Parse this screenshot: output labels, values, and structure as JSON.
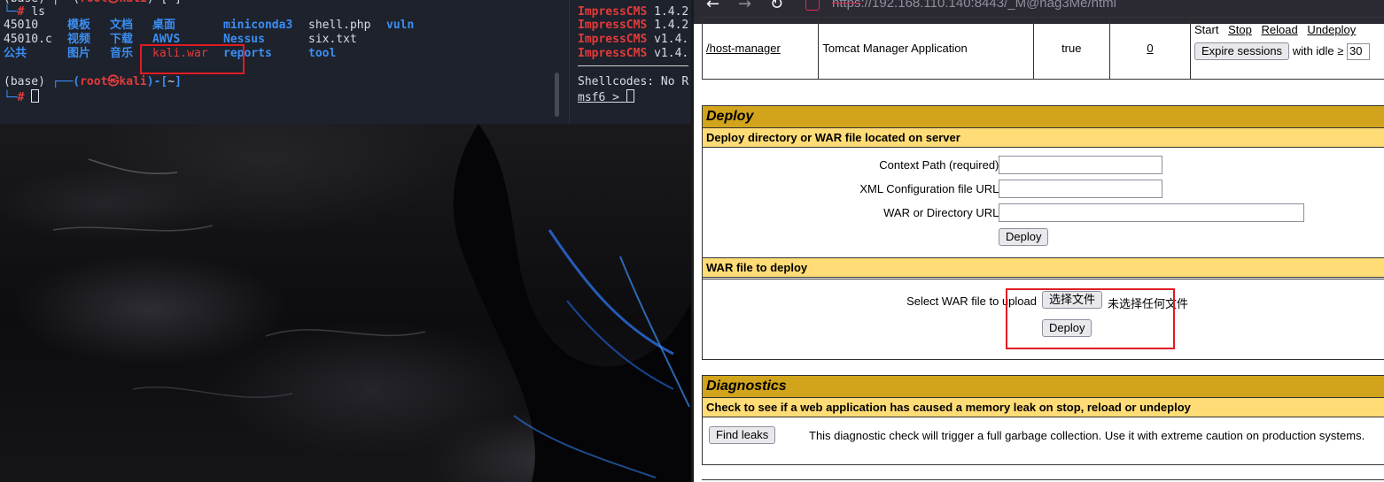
{
  "terminal_left": {
    "prompt_env": "(base)",
    "prompt_user": "root",
    "prompt_host": "kali",
    "prompt_dir": "~",
    "last_command": "ls",
    "ls_rows": [
      [
        "45010",
        "模板",
        "文档",
        "桌面",
        "miniconda3",
        "shell.php",
        "vuln"
      ],
      [
        "45010.c",
        "视频",
        "下载",
        "AWVS",
        "Nessus",
        "six.txt",
        ""
      ],
      [
        "公共",
        "图片",
        "音乐",
        "kali.war",
        "reports",
        "tool",
        ""
      ]
    ]
  },
  "terminal_right": {
    "search_rows": [
      [
        "ImpressCMS",
        "1.4.2"
      ],
      [
        "ImpressCMS",
        "1.4.2"
      ],
      [
        "ImpressCMS",
        "v1.4."
      ],
      [
        "ImpressCMS",
        "v1.4."
      ]
    ],
    "shellcodes_line": "Shellcodes: No R",
    "prompt": "msf6 > "
  },
  "browser": {
    "url_scheme": "https",
    "url_rest": "://192.168.110.140:8443/_M@nag3Me/html",
    "icons": {
      "back": "back-arrow-icon",
      "forward": "forward-arrow-icon",
      "reload": "reload-icon",
      "lock": "insecure-lock-icon"
    }
  },
  "app_row": {
    "path": "/host-manager",
    "display_name": "Tomcat Manager Application",
    "running": "true",
    "sessions": "0",
    "commands": [
      "Start",
      "Stop",
      "Reload",
      "Undeploy"
    ],
    "expire_button": "Expire sessions",
    "idle_label": "with idle ≥",
    "idle_value": "30"
  },
  "deploy": {
    "title": "Deploy",
    "server_subtitle": "Deploy directory or WAR file located on server",
    "context_path_label": "Context Path (required):",
    "xml_config_label": "XML Configuration file URL:",
    "war_url_label": "WAR or Directory URL:",
    "deploy_button": "Deploy",
    "war_subtitle": "WAR file to deploy",
    "select_war_label": "Select WAR file to upload",
    "choose_file_button": "选择文件",
    "no_file_text": "未选择任何文件",
    "upload_deploy_button": "Deploy"
  },
  "diagnostics": {
    "title": "Diagnostics",
    "subtitle": "Check to see if a web application has caused a memory leak on stop, reload or undeploy",
    "find_leaks_button": "Find leaks",
    "description": "This diagnostic check will trigger a full garbage collection. Use it with extreme caution on production systems."
  },
  "colors": {
    "terminal_bg": "#1d222c",
    "section_title_bg": "#d2a41c",
    "section_sub_bg": "#ffdc75",
    "highlight_box": "#e01b24"
  }
}
